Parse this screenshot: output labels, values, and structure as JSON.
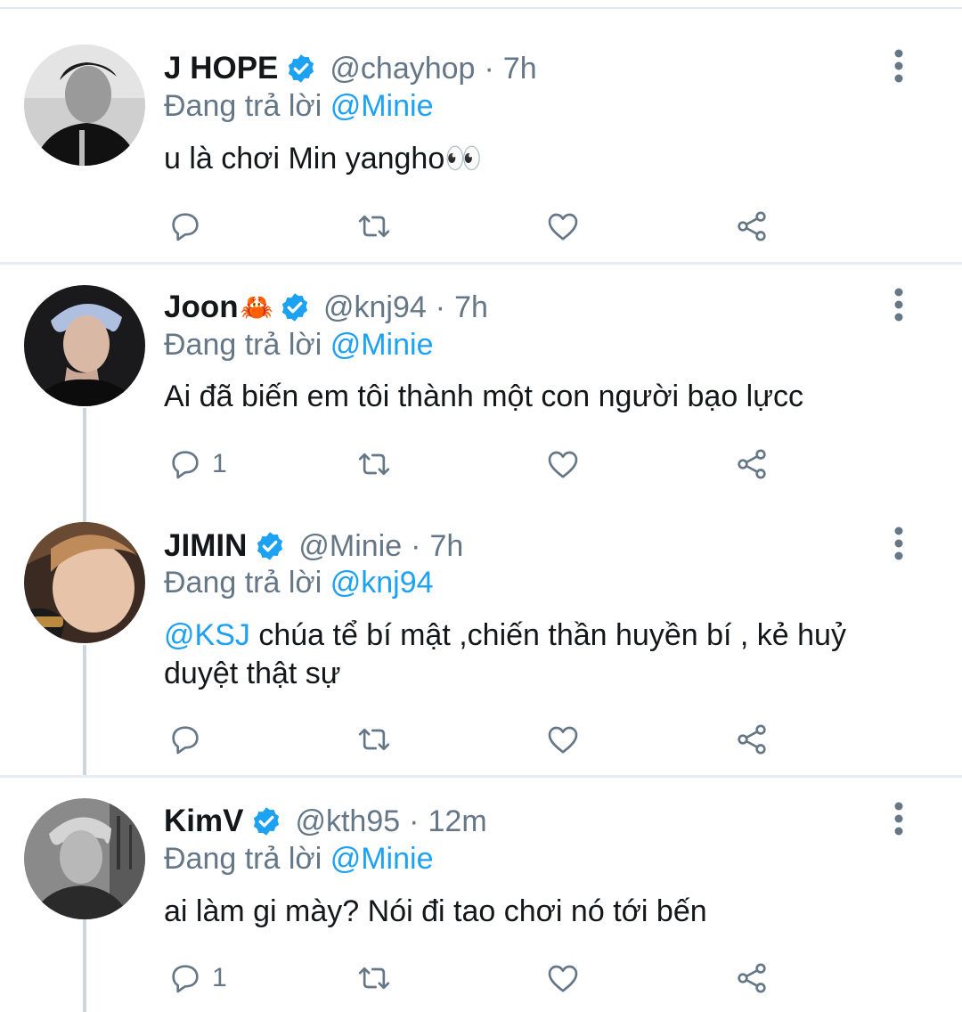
{
  "replying_label": "Đang trả lời",
  "colors": {
    "accent": "#1da1f2",
    "secondary_text": "#657786",
    "divider": "#e6ecf0"
  },
  "icons": {
    "reply": "reply-icon",
    "retweet": "retweet-icon",
    "like": "heart-icon",
    "share": "share-icon",
    "more": "more-vertical-icon",
    "verified": "verified-badge-icon"
  },
  "tweets": [
    {
      "name": "J HOPE",
      "name_emoji": "",
      "handle": "@chayhop",
      "separator": "·",
      "time": "7h",
      "reply_to": "@Minie",
      "text_mention": "",
      "text": "u là chơi Min yangho👀",
      "reply_count": ""
    },
    {
      "name": "Joon",
      "name_emoji": "🦀",
      "handle": "@knj94",
      "separator": "·",
      "time": "7h",
      "reply_to": "@Minie",
      "text_mention": "",
      "text": "Ai đã biến em tôi thành một con người bạo lựcc",
      "reply_count": "1"
    },
    {
      "name": "JIMIN",
      "name_emoji": "",
      "handle": "@Minie",
      "separator": "·",
      "time": "7h",
      "reply_to": "@knj94",
      "text_mention": "@KSJ",
      "text": " chúa tể bí mật ,chiến thần huyền bí , kẻ huỷ duyệt thật sự",
      "reply_count": ""
    },
    {
      "name": "KimV",
      "name_emoji": "",
      "handle": "@kth95",
      "separator": "·",
      "time": "12m",
      "reply_to": "@Minie",
      "text_mention": "",
      "text": "ai làm gi mày? Nói đi tao chơi nó tới bến",
      "reply_count": "1"
    }
  ]
}
